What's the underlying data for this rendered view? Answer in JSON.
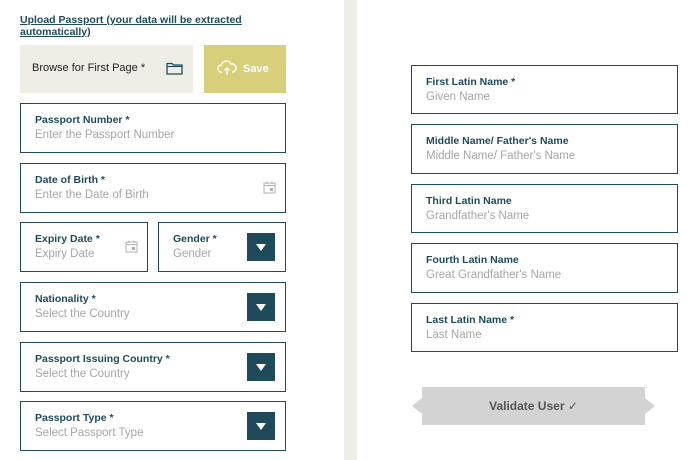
{
  "upload": {
    "link_text": "Upload Passport (your data will be extracted automatically)",
    "browse_label": "Browse for First Page *",
    "save_label": "Save"
  },
  "left_fields": {
    "passport_number": {
      "label": "Passport Number *",
      "placeholder": "Enter the Passport Number"
    },
    "date_of_birth": {
      "label": "Date of Birth *",
      "placeholder": "Enter the Date of Birth"
    },
    "expiry_date": {
      "label": "Expiry Date *",
      "placeholder": "Expiry Date"
    },
    "gender": {
      "label": "Gender *",
      "placeholder": "Gender"
    },
    "nationality": {
      "label": "Nationality *",
      "placeholder": "Select the Country"
    },
    "issuing_country": {
      "label": "Passport Issuing Country *",
      "placeholder": "Select the Country"
    },
    "passport_type": {
      "label": "Passport Type *",
      "placeholder": "Select Passport Type"
    }
  },
  "right_fields": {
    "first_name": {
      "label": "First Latin Name *",
      "placeholder": "Given Name"
    },
    "middle_name": {
      "label": "Middle Name/ Father's Name",
      "placeholder": "Middle Name/ Father's Name"
    },
    "third_name": {
      "label": "Third Latin Name",
      "placeholder": "Grandfather's Name"
    },
    "fourth_name": {
      "label": "Fourth Latin Name",
      "placeholder": "Great Grandfather's Name"
    },
    "last_name": {
      "label": "Last Latin Name *",
      "placeholder": "Last Name"
    }
  },
  "validate": {
    "label": "Validate User ✓"
  },
  "colors": {
    "primary": "#1f4a5a",
    "save_bg": "#d8cf7b",
    "panel_bg": "#efeee6",
    "validate_bg": "#d3d3d3"
  }
}
